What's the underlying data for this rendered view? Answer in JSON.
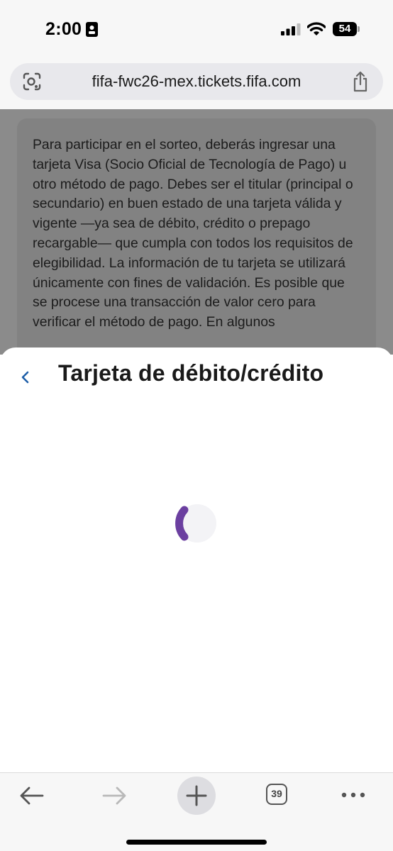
{
  "status_bar": {
    "time": "2:00",
    "battery_level": "54",
    "icons": [
      "id-card-icon",
      "signal-bars-icon",
      "wifi-icon",
      "battery-icon"
    ]
  },
  "browser": {
    "url": "fifa-fwc26-mex.tickets.fifa.com",
    "icons": [
      "lens-icon",
      "share-icon"
    ]
  },
  "background_page": {
    "paragraph": "Para participar en el sorteo, deberás ingresar una tarjeta Visa (Socio Oficial de Tecnología de Pago) u otro método de pago. Debes ser el titular (principal o secundario) en buen estado de una tarjeta válida y vigente —ya sea de débito, crédito o prepago recargable— que cumpla con todos los requisitos de elegibilidad. La información de tu tarjeta se utilizará únicamente con fines de validación. Es posible que se procese una transacción de valor cero para verificar el método de pago. En algunos"
  },
  "sheet": {
    "title": "Tarjeta de débito/crédito",
    "back_icon": "chevron-left-icon",
    "loading": true,
    "spinner_color": "#6b3fa0"
  },
  "toolbar": {
    "tab_count": "39",
    "icons": [
      "back-arrow-icon",
      "forward-arrow-icon",
      "plus-icon",
      "tabs-icon",
      "more-icon"
    ]
  },
  "colors": {
    "accent": "#1f5fa8",
    "overlay": "#8b8b8b"
  }
}
